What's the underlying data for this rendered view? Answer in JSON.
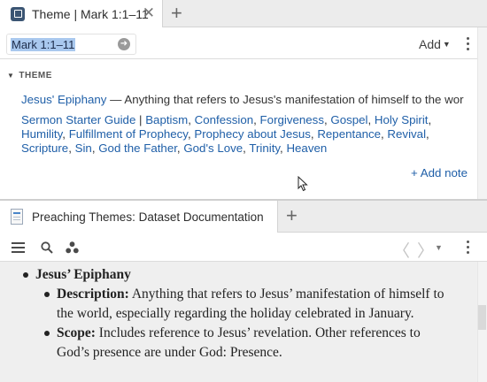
{
  "top_pane": {
    "tab_title": "Theme | Mark 1:1–11",
    "reference_input_value": "Mark 1:1–11",
    "add_label": "Add",
    "section_label": "THEME",
    "theme": {
      "name": "Jesus' Epiphany",
      "separator": " — ",
      "description": "Anything that refers to Jesus's manifestation of himself to the worl…"
    },
    "guide": {
      "name": "Sermon Starter Guide",
      "separator": " | ",
      "topics": [
        "Baptism",
        "Confession",
        "Forgiveness",
        "Gospel",
        "Holy Spirit",
        "Humility",
        "Fulfillment of Prophecy",
        "Prophecy about Jesus",
        "Repentance",
        "Revival",
        "Scripture",
        "Sin",
        "God the Father",
        "God's Love",
        "Trinity",
        "Heaven"
      ]
    },
    "add_note_label": "+ Add note"
  },
  "bottom_pane": {
    "tab_title": "Preaching Themes: Dataset Documentation",
    "entry": {
      "title": "Jesus’ Epiphany",
      "description_label": "Description:",
      "description_text": " Anything that refers to Jesus’ manifestation of himself to the world, especially regarding the holiday celebrated in January.",
      "scope_label": "Scope:",
      "scope_text": " Includes reference to Jesus’ revelation. Other references to God’s presence are under God: Presence."
    }
  },
  "icons": {
    "tab_doc": "document-icon",
    "close": "close-icon",
    "new_tab": "plus-icon",
    "go": "go-arrow-icon",
    "more": "kebab-icon",
    "menu": "hamburger-icon",
    "search": "search-icon",
    "visual_filter": "dots-cluster-icon",
    "back": "back-arrow-icon",
    "forward": "forward-arrow-icon",
    "dropdown": "chevron-down-icon",
    "resource": "book-icon",
    "pointer": "mouse-pointer-icon"
  },
  "colors": {
    "link": "#1f5fa8",
    "selection": "#a9c8ee",
    "tab_icon": "#3b5573",
    "content_bg": "#efefef"
  }
}
